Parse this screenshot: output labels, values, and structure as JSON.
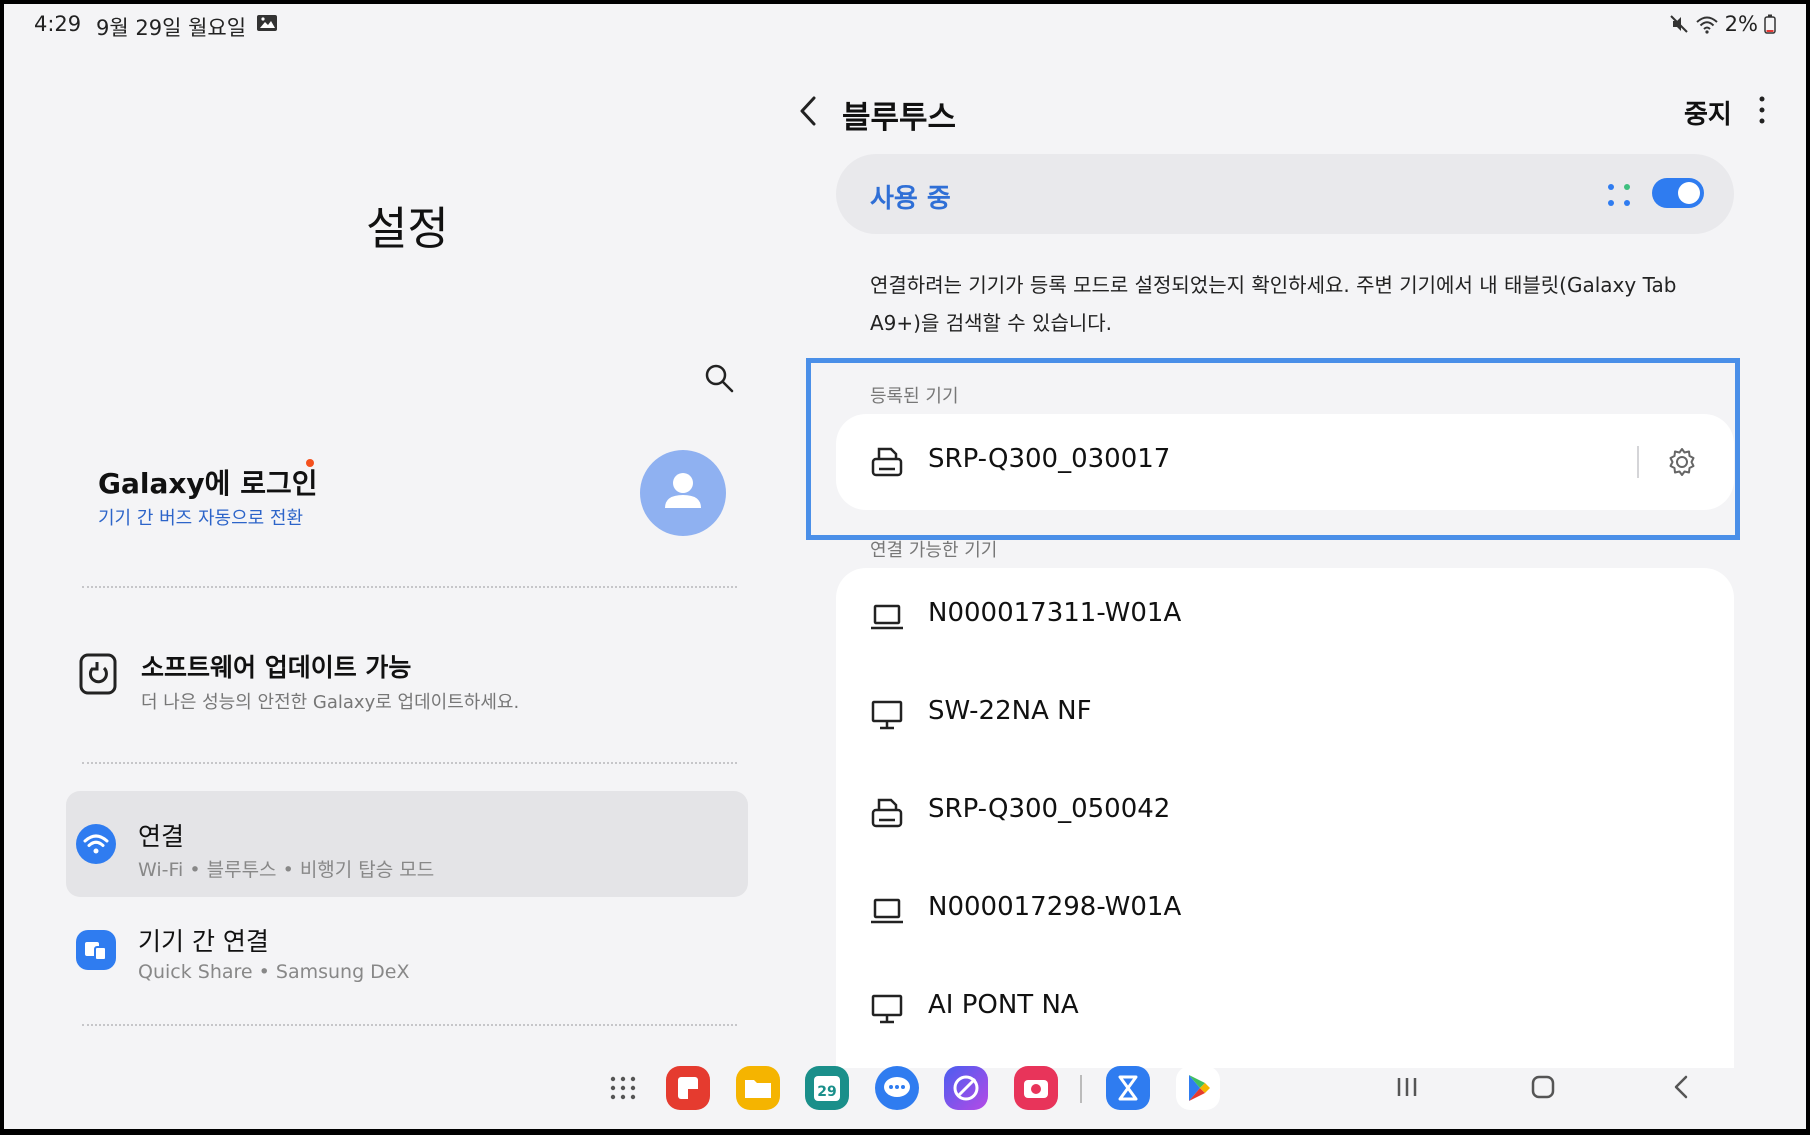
{
  "status_bar": {
    "time": "4:29",
    "date": "9월 29일 월요일",
    "battery": "2%"
  },
  "left": {
    "title": "설정",
    "login": {
      "title": "Galaxy에 로그인",
      "subtitle": "기기 간 버즈 자동으로 전환"
    },
    "menu": [
      {
        "title": "소프트웨어 업데이트 가능",
        "subtitle": "더 나은 성능의 안전한 Galaxy로 업데이트하세요."
      },
      {
        "title": "연결",
        "subtitle": "Wi-Fi • 블루투스 • 비행기 탑승 모드",
        "selected": true
      },
      {
        "title": "기기 간 연결",
        "subtitle": "Quick Share • Samsung DeX"
      }
    ]
  },
  "right": {
    "title": "블루투스",
    "stop_label": "중지",
    "toggle_label": "사용 중",
    "toggle_on": true,
    "info": "연결하려는 기기가 등록 모드로 설정되었는지 확인하세요. 주변 기기에서 내 태블릿(Galaxy Tab A9+)을 검색할 수 있습니다.",
    "registered_label": "등록된 기기",
    "registered": [
      {
        "name": "SRP-Q300_030017",
        "icon": "printer-icon"
      }
    ],
    "available_label": "연결 가능한 기기",
    "available": [
      {
        "name": "N000017311-W01A",
        "icon": "laptop-icon"
      },
      {
        "name": "SW-22NA NF",
        "icon": "monitor-icon"
      },
      {
        "name": "SRP-Q300_050042",
        "icon": "printer-icon"
      },
      {
        "name": "N000017298-W01A",
        "icon": "laptop-icon"
      },
      {
        "name": "AI PONT NA",
        "icon": "monitor-icon"
      }
    ]
  },
  "taskbar": {
    "calendar_day": "29"
  },
  "colors": {
    "accent": "#2f7cf0",
    "highlight": "#4a8fe8",
    "background": "#f4f4f6"
  }
}
